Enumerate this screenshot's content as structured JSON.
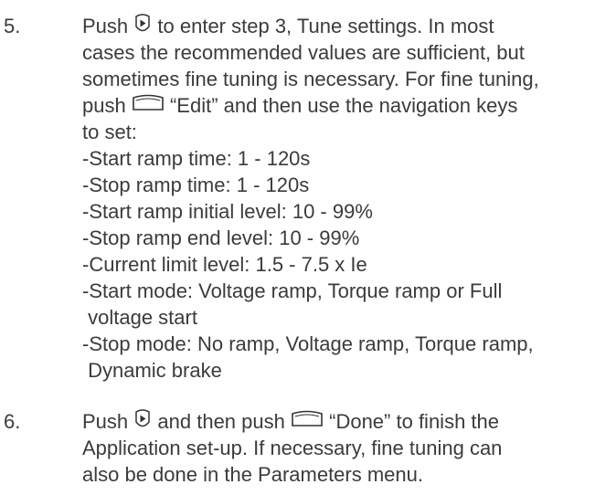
{
  "steps": [
    {
      "number": "5.",
      "line1": {
        "pre": "Push",
        "post": "to enter step 3, Tune settings. In most",
        "icon": "right-arrow-circle-icon"
      },
      "line2": "cases the recommended values are sufficient, but",
      "line3": "sometimes fine tuning is necessary. For fine tuning,",
      "line4": {
        "pre": "push",
        "post": "“Edit” and then use the navigation keys",
        "icon": "softkey-icon"
      },
      "line5": "to set:",
      "settings": [
        "-Start ramp time: 1 - 120s",
        "-Stop ramp time: 1 - 120s",
        "-Start ramp initial level: 10 - 99%",
        "-Stop ramp end level: 10 - 99%",
        "-Current limit level: 1.5 - 7.5 x Ie",
        "-Start mode: Voltage ramp, Torque ramp or Full",
        " voltage start",
        "-Stop mode: No ramp, Voltage ramp, Torque ramp,",
        " Dynamic brake"
      ]
    },
    {
      "number": "6.",
      "line1": {
        "pre": "Push",
        "mid": "and then push",
        "post": "“Done” to finish the",
        "icon1": "right-arrow-circle-icon",
        "icon2": "softkey-icon"
      },
      "line2": "Application set-up. If necessary, fine tuning can",
      "line3": "also be done in the Parameters menu."
    }
  ]
}
